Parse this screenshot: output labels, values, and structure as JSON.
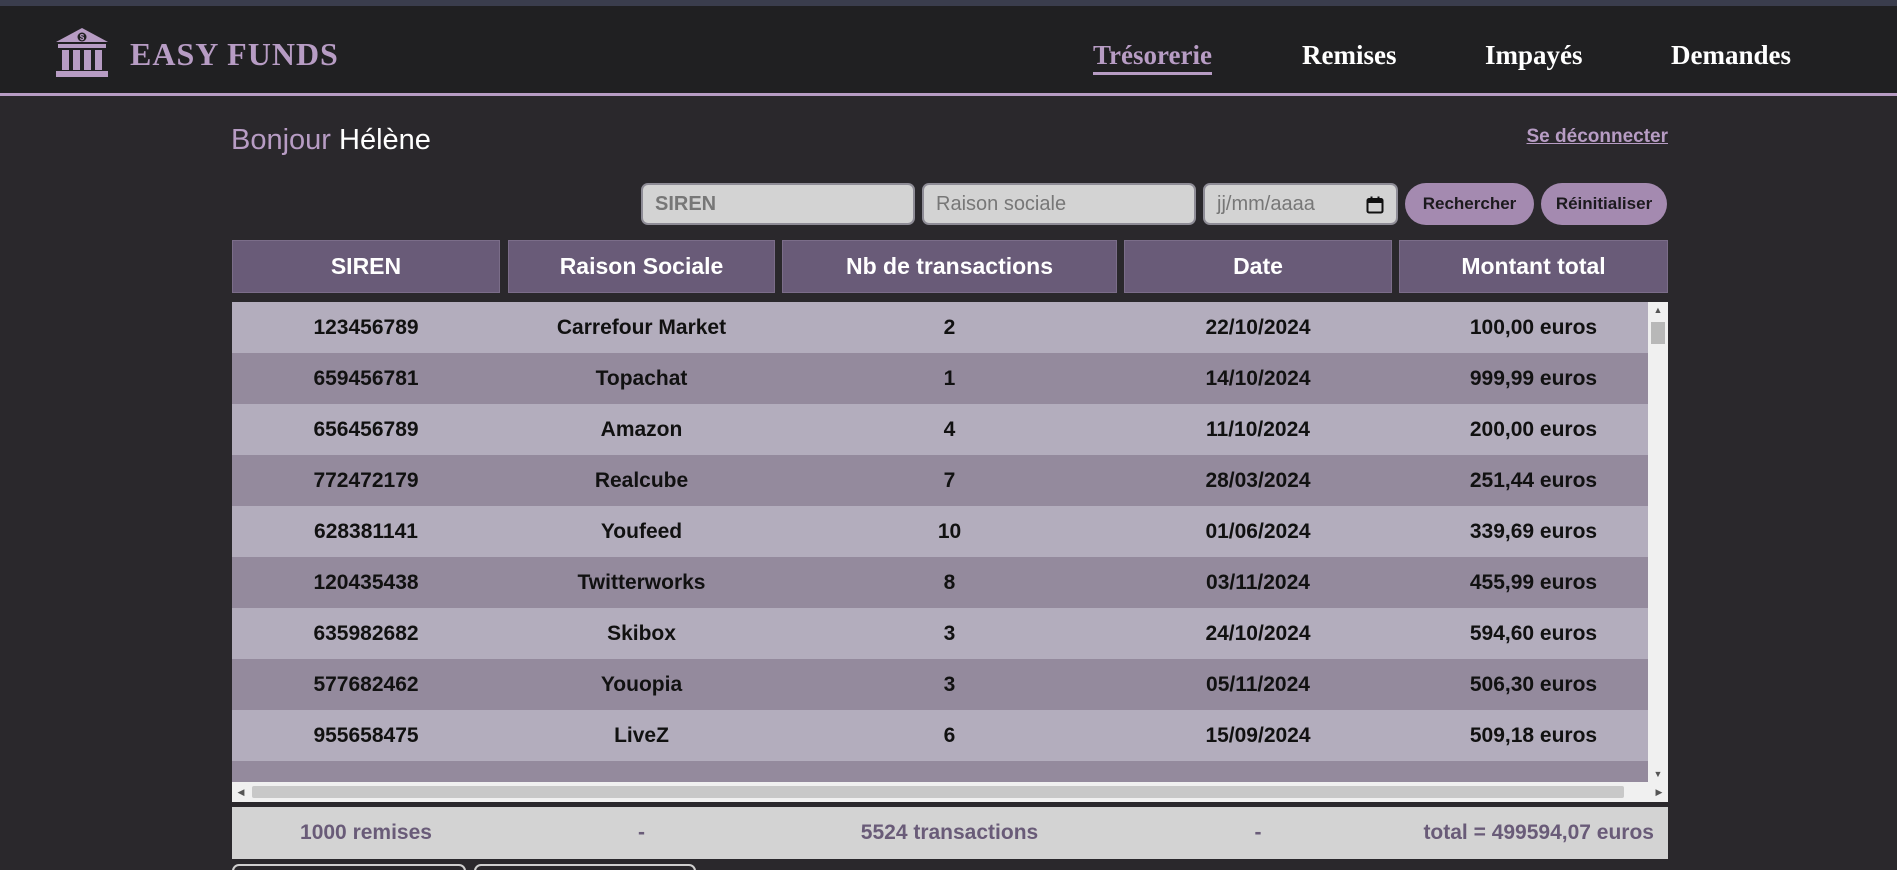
{
  "app": {
    "name": "EASY FUNDS",
    "logo_icon": "bank-icon"
  },
  "nav": {
    "items": [
      {
        "label": "Trésorerie",
        "active": true
      },
      {
        "label": "Remises",
        "active": false
      },
      {
        "label": "Impayés",
        "active": false
      },
      {
        "label": "Demandes",
        "active": false
      }
    ]
  },
  "greeting": {
    "prefix": "Bonjour",
    "name": "Hélène"
  },
  "logout_label": "Se déconnecter",
  "search": {
    "siren_placeholder": "SIREN",
    "raison_placeholder": "Raison sociale",
    "date_placeholder": "jj/mm/aaaa",
    "search_label": "Rechercher",
    "reset_label": "Réinitialiser"
  },
  "table": {
    "columns": [
      "SIREN",
      "Raison Sociale",
      "Nb de transactions",
      "Date",
      "Montant total"
    ],
    "rows": [
      [
        "123456789",
        "Carrefour Market",
        "2",
        "22/10/2024",
        "100,00 euros"
      ],
      [
        "659456781",
        "Topachat",
        "1",
        "14/10/2024",
        "999,99 euros"
      ],
      [
        "656456789",
        "Amazon",
        "4",
        "11/10/2024",
        "200,00 euros"
      ],
      [
        "772472179",
        "Realcube",
        "7",
        "28/03/2024",
        "251,44 euros"
      ],
      [
        "628381141",
        "Youfeed",
        "10",
        "01/06/2024",
        "339,69 euros"
      ],
      [
        "120435438",
        "Twitterworks",
        "8",
        "03/11/2024",
        "455,99 euros"
      ],
      [
        "635982682",
        "Skibox",
        "3",
        "24/10/2024",
        "594,60 euros"
      ],
      [
        "577682462",
        "Youopia",
        "3",
        "05/11/2024",
        "506,30 euros"
      ],
      [
        "955658475",
        "LiveZ",
        "6",
        "15/09/2024",
        "509,18 euros"
      ]
    ]
  },
  "footer": {
    "remises": "1000 remises",
    "dash1": "-",
    "transactions": "5524 transactions",
    "dash2": "-",
    "total": "total = 499594,07 euros"
  },
  "colors": {
    "accent": "#b79cc4",
    "header_bg": "#695b78",
    "row_light": "#b3adbd",
    "row_dark": "#948a9d"
  }
}
